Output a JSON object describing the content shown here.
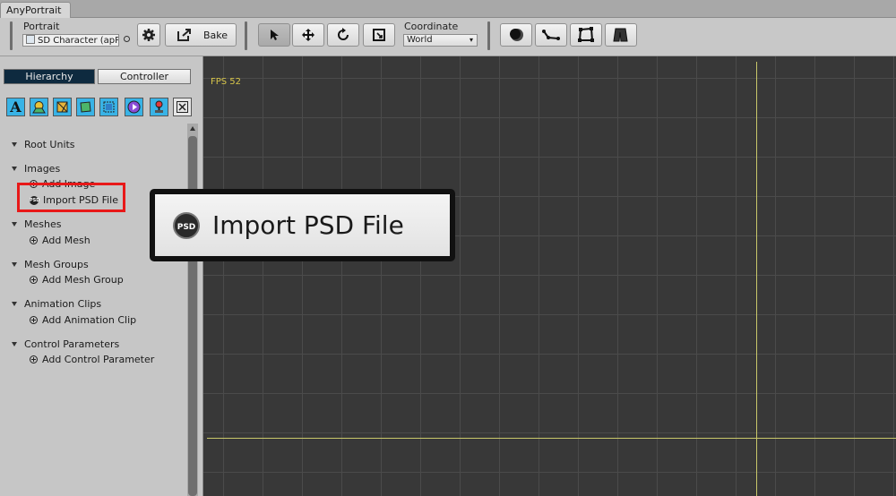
{
  "window": {
    "tab_title": "AnyPortrait"
  },
  "toolbar": {
    "portrait_label": "Portrait",
    "portrait_value": "SD Character (apP",
    "bake_label": "Bake",
    "coordinate_label": "Coordinate",
    "coordinate_value": "World",
    "tools": [
      "select-tool-icon",
      "move-tool-icon",
      "rotate-tool-icon",
      "scale-tool-icon"
    ],
    "modes": [
      "onion-skin-icon",
      "bone-icon",
      "mesh-icon",
      "physics-icon"
    ]
  },
  "left_panel": {
    "tabs": [
      {
        "label": "Hierarchy",
        "active": true
      },
      {
        "label": "Controller",
        "active": false
      }
    ],
    "filter_icons": [
      "text-filter-icon",
      "image-filter-icon",
      "mesh-filter-icon",
      "mesh-group-filter-icon",
      "modifier-filter-icon",
      "animation-filter-icon",
      "control-param-filter-icon",
      "close-filter-icon"
    ],
    "tree": [
      {
        "label": "Root Units",
        "children": []
      },
      {
        "label": "Images",
        "children": [
          {
            "label": "Add Image",
            "icon": "plus-icon"
          },
          {
            "label": "Import PSD File",
            "icon": "psd-icon"
          }
        ]
      },
      {
        "label": "Meshes",
        "children": [
          {
            "label": "Add Mesh",
            "icon": "plus-icon"
          }
        ]
      },
      {
        "label": "Mesh Groups",
        "children": [
          {
            "label": "Add Mesh Group",
            "icon": "plus-icon"
          }
        ]
      },
      {
        "label": "Animation Clips",
        "children": [
          {
            "label": "Add Animation Clip",
            "icon": "plus-icon"
          }
        ]
      },
      {
        "label": "Control Parameters",
        "children": [
          {
            "label": "Add Control Parameter",
            "icon": "plus-icon"
          }
        ]
      }
    ]
  },
  "viewport": {
    "fps_text": "FPS 52"
  },
  "callout": {
    "label": "Import PSD File",
    "icon": "psd-icon"
  },
  "colors": {
    "accent_active_tab": "#0e2a3f",
    "highlight_red": "#e81818",
    "viewport_bg": "#383838",
    "axis_yellow": "#c9c86a",
    "fps_yellow": "#d8c64a",
    "icon_blue": "#39b3e6"
  }
}
